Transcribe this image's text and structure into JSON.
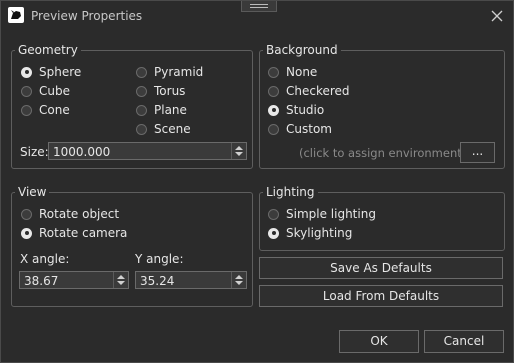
{
  "window": {
    "title": "Preview Properties",
    "app_icon": "rhino-icon",
    "close_icon": "close-icon"
  },
  "geometry": {
    "legend": "Geometry",
    "options": [
      {
        "label": "Sphere",
        "checked": true
      },
      {
        "label": "Cube",
        "checked": false
      },
      {
        "label": "Cone",
        "checked": false
      },
      {
        "label": "Pyramid",
        "checked": false
      },
      {
        "label": "Torus",
        "checked": false
      },
      {
        "label": "Plane",
        "checked": false
      },
      {
        "label": "Scene",
        "checked": false
      }
    ],
    "size_label": "Size:",
    "size_value": "1000.000"
  },
  "background": {
    "legend": "Background",
    "options": [
      {
        "label": "None",
        "checked": false
      },
      {
        "label": "Checkered",
        "checked": false
      },
      {
        "label": "Studio",
        "checked": true
      },
      {
        "label": "Custom",
        "checked": false
      }
    ],
    "assign_hint": "(click to assign environment)",
    "browse_button": "..."
  },
  "view": {
    "legend": "View",
    "options": [
      {
        "label": "Rotate object",
        "checked": false
      },
      {
        "label": "Rotate camera",
        "checked": true
      }
    ],
    "x_angle_label": "X angle:",
    "x_angle_value": "38.67",
    "y_angle_label": "Y angle:",
    "y_angle_value": "35.24"
  },
  "lighting": {
    "legend": "Lighting",
    "options": [
      {
        "label": "Simple lighting",
        "checked": false
      },
      {
        "label": "Skylighting",
        "checked": true
      }
    ]
  },
  "buttons": {
    "save_defaults": "Save As Defaults",
    "load_defaults": "Load From Defaults",
    "ok": "OK",
    "cancel": "Cancel"
  },
  "colors": {
    "background": "#2b2b2b",
    "border": "#5e5e5e",
    "text": "#e6e6e6",
    "hint": "#8a8a8a"
  }
}
